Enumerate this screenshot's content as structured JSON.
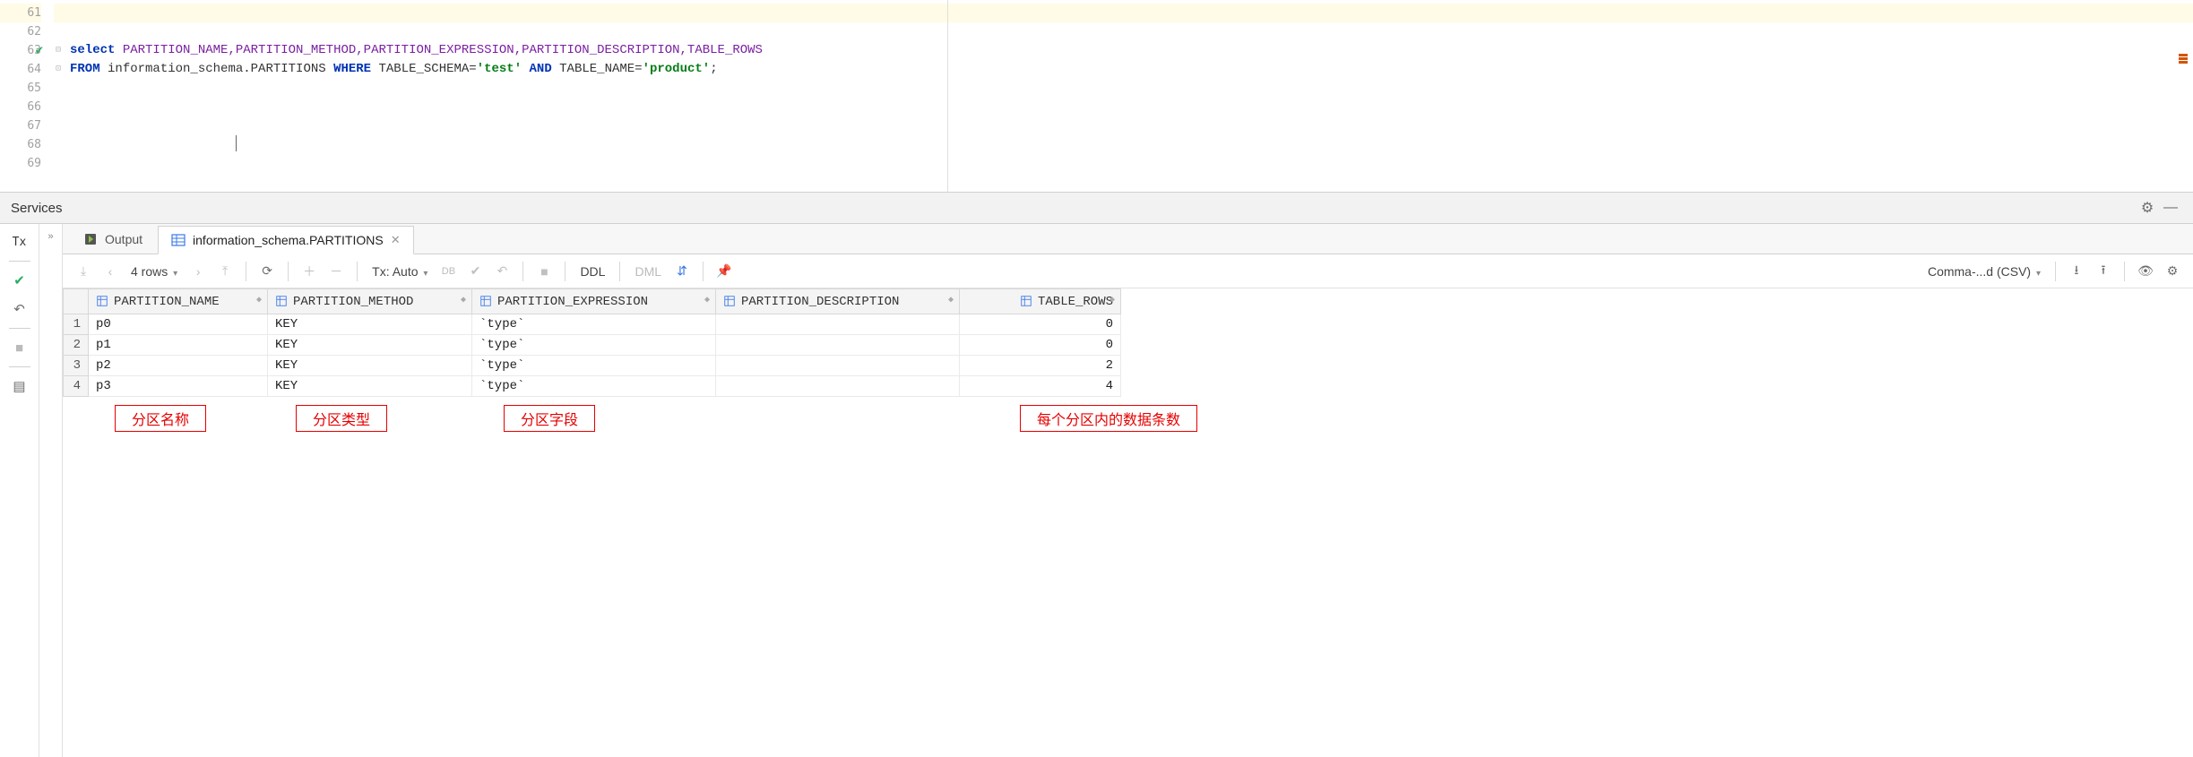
{
  "editor": {
    "lines": [
      61,
      62,
      63,
      64,
      65,
      66,
      67,
      68,
      69
    ],
    "highlight_line": 61,
    "check_line": 63,
    "line63": {
      "kw_select": "select",
      "cols": "PARTITION_NAME,PARTITION_METHOD,PARTITION_EXPRESSION,PARTITION_DESCRIPTION,TABLE_ROWS"
    },
    "line64": {
      "kw_from": "FROM",
      "id1": "information_schema.PARTITIONS",
      "kw_where": "WHERE",
      "id2": "TABLE_SCHEMA=",
      "str1": "'test'",
      "kw_and": "AND",
      "id3": "TABLE_NAME=",
      "str2": "'product'",
      "semi": ";"
    }
  },
  "services": {
    "title": "Services"
  },
  "left": {
    "tx_label": "Tx"
  },
  "tabs": {
    "output_label": "Output",
    "active_label": "information_schema.PARTITIONS"
  },
  "toolbar": {
    "rows_label": "4 rows",
    "tx_label": "Tx: Auto",
    "ddl": "DDL",
    "dml": "DML",
    "export_label": "Comma-...d (CSV)"
  },
  "table": {
    "headers": [
      "PARTITION_NAME",
      "PARTITION_METHOD",
      "PARTITION_EXPRESSION",
      "PARTITION_DESCRIPTION",
      "TABLE_ROWS"
    ],
    "rows": [
      {
        "n": 1,
        "name": "p0",
        "method": "KEY",
        "expr": "`type`",
        "desc": "<null>",
        "rows": "0"
      },
      {
        "n": 2,
        "name": "p1",
        "method": "KEY",
        "expr": "`type`",
        "desc": "<null>",
        "rows": "0"
      },
      {
        "n": 3,
        "name": "p2",
        "method": "KEY",
        "expr": "`type`",
        "desc": "<null>",
        "rows": "2"
      },
      {
        "n": 4,
        "name": "p3",
        "method": "KEY",
        "expr": "`type`",
        "desc": "<null>",
        "rows": "4"
      }
    ]
  },
  "annotations": {
    "a1": "分区名称",
    "a2": "分区类型",
    "a3": "分区字段",
    "a4": "每个分区内的数据条数"
  },
  "chart_data": {
    "type": "table",
    "headers": [
      "PARTITION_NAME",
      "PARTITION_METHOD",
      "PARTITION_EXPRESSION",
      "PARTITION_DESCRIPTION",
      "TABLE_ROWS"
    ],
    "rows": [
      [
        "p0",
        "KEY",
        "`type`",
        null,
        0
      ],
      [
        "p1",
        "KEY",
        "`type`",
        null,
        0
      ],
      [
        "p2",
        "KEY",
        "`type`",
        null,
        2
      ],
      [
        "p3",
        "KEY",
        "`type`",
        null,
        4
      ]
    ]
  }
}
